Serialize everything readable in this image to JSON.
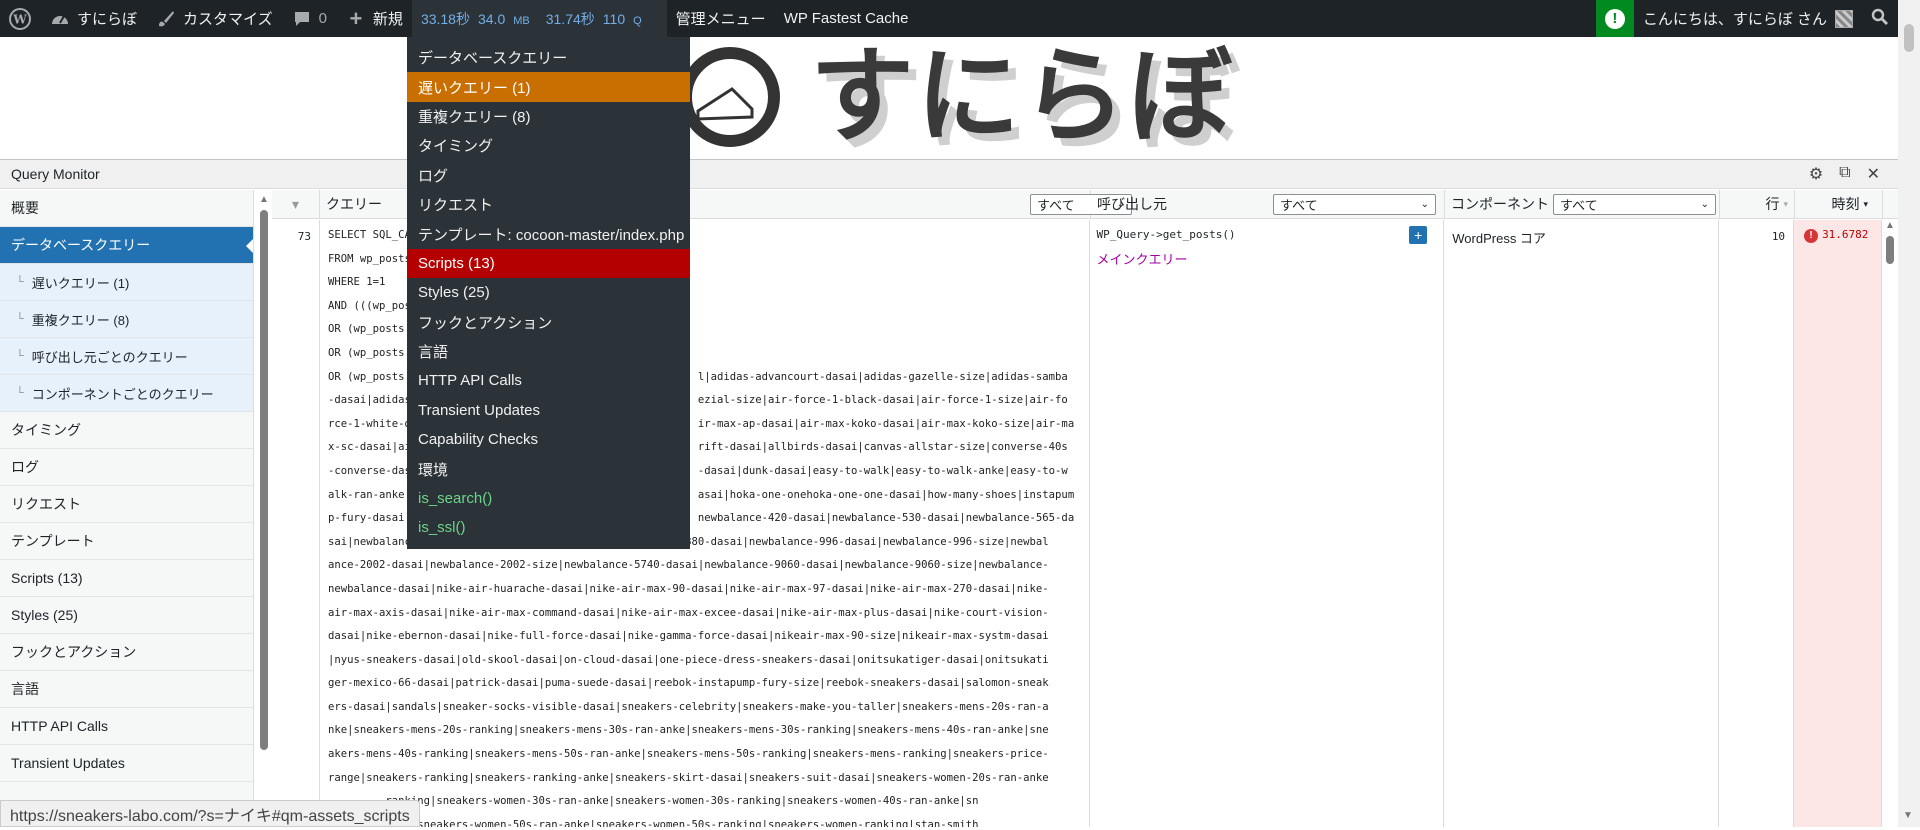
{
  "adminbar": {
    "site_name": "すにらぼ",
    "customize": "カスタマイズ",
    "comments_count": "0",
    "new": "新規",
    "qm_time": "33.18秒",
    "qm_memory": "34.0",
    "qm_memory_unit": "MB",
    "qm_db_time": "31.74秒",
    "qm_queries": "110",
    "qm_queries_unit": "Q",
    "admin_menu": "管理メニュー",
    "wp_fastest_cache": "WP Fastest Cache",
    "greeting": "こんにちは、すにらぼ さん"
  },
  "site": {
    "logo_text": "すにらぼ"
  },
  "qm_menu": [
    {
      "label": "データベースクエリー",
      "kind": "normal"
    },
    {
      "label": "遅いクエリー (1)",
      "kind": "warn"
    },
    {
      "label": "重複クエリー (8)",
      "kind": "normal"
    },
    {
      "label": "タイミング",
      "kind": "normal"
    },
    {
      "label": "ログ",
      "kind": "normal"
    },
    {
      "label": "リクエスト",
      "kind": "normal"
    },
    {
      "label": "テンプレート: cocoon-master/index.php",
      "kind": "normal"
    },
    {
      "label": "Scripts (13)",
      "kind": "error"
    },
    {
      "label": "Styles (25)",
      "kind": "normal"
    },
    {
      "label": "フックとアクション",
      "kind": "normal"
    },
    {
      "label": "言語",
      "kind": "normal"
    },
    {
      "label": "HTTP API Calls",
      "kind": "normal"
    },
    {
      "label": "Transient Updates",
      "kind": "normal"
    },
    {
      "label": "Capability Checks",
      "kind": "normal"
    },
    {
      "label": "環境",
      "kind": "normal"
    },
    {
      "label": "is_search()",
      "kind": "green"
    },
    {
      "label": "is_ssl()",
      "kind": "green"
    }
  ],
  "qm_panel": {
    "title": "Query Monitor",
    "nav": [
      {
        "label": "概要",
        "kind": "normal"
      },
      {
        "label": "データベースクエリー",
        "kind": "active"
      },
      {
        "label": "遅いクエリー (1)",
        "kind": "sub"
      },
      {
        "label": "重複クエリー (8)",
        "kind": "sub"
      },
      {
        "label": "呼び出し元ごとのクエリー",
        "kind": "sub"
      },
      {
        "label": "コンポーネントごとのクエリー",
        "kind": "sub"
      },
      {
        "label": "タイミング",
        "kind": "normal"
      },
      {
        "label": "ログ",
        "kind": "normal"
      },
      {
        "label": "リクエスト",
        "kind": "normal"
      },
      {
        "label": "テンプレート",
        "kind": "normal"
      },
      {
        "label": "Scripts (13)",
        "kind": "normal"
      },
      {
        "label": "Styles (25)",
        "kind": "normal"
      },
      {
        "label": "フックとアクション",
        "kind": "normal"
      },
      {
        "label": "言語",
        "kind": "normal"
      },
      {
        "label": "HTTP API Calls",
        "kind": "normal"
      },
      {
        "label": "Transient Updates",
        "kind": "normal"
      }
    ],
    "columns": {
      "query": "クエリー",
      "query_filter": "すべて",
      "caller": "呼び出し元",
      "caller_filter": "すべて",
      "component": "コンポーネント",
      "component_filter": "すべて",
      "rows": "行",
      "time": "時刻"
    },
    "row": {
      "number": "73",
      "sql_lines": [
        "SELECT SQL_CA",
        "FROM wp_posts",
        "WHERE 1=1",
        "AND (((wp_pos",
        "OR (wp_posts.",
        "OR (wp_posts.",
        "OR (wp_posts.                                             l|adidas-advancourt-dasai|adidas-gazelle-size|adidas-samba",
        "-dasai|adidas                                             ezial-size|air-force-1-black-dasai|air-force-1-size|air-fo",
        "rce-1-white-d                                             ir-max-ap-dasai|air-max-koko-dasai|air-max-koko-size|air-ma",
        "x-sc-dasai|ai                                             rift-dasai|allbirds-dasai|canvas-allstar-size|converse-40s",
        "-converse-das                                             -dasai|dunk-dasai|easy-to-walk|easy-to-walk-anke|easy-to-w",
        "alk-ran-anke|                                             asai|hoka-one-onehoka-one-one-dasai|how-many-shoes|instapum",
        "p-fury-dasai|                                             newbalance-420-dasai|newbalance-530-dasai|newbalance-565-da",
        "sai|newbalance-574-dasai|newbalance-574-size|newbalance-880-dasai|newbalance-996-dasai|newbalance-996-size|newbal",
        "ance-2002-dasai|newbalance-2002-size|newbalance-5740-dasai|newbalance-9060-dasai|newbalance-9060-size|newbalance-",
        "newbalance-dasai|nike-air-huarache-dasai|nike-air-max-90-dasai|nike-air-max-97-dasai|nike-air-max-270-dasai|nike-",
        "air-max-axis-dasai|nike-air-max-command-dasai|nike-air-max-excee-dasai|nike-air-max-plus-dasai|nike-court-vision-",
        "dasai|nike-ebernon-dasai|nike-full-force-dasai|nike-gamma-force-dasai|nikeair-max-90-size|nikeair-max-systm-dasai",
        "|nyus-sneakers-dasai|old-skool-dasai|on-cloud-dasai|one-piece-dress-sneakers-dasai|onitsukatiger-dasai|onitsukati",
        "ger-mexico-66-dasai|patrick-dasai|puma-suede-dasai|reebok-instapump-fury-size|reebok-sneakers-dasai|salomon-sneak",
        "ers-dasai|sandals|sneaker-socks-visible-dasai|sneakers-celebrity|sneakers-make-you-taller|sneakers-mens-20s-ran-a",
        "nke|sneakers-mens-20s-ranking|sneakers-mens-30s-ran-anke|sneakers-mens-30s-ranking|sneakers-mens-40s-ran-anke|sne",
        "akers-mens-40s-ranking|sneakers-mens-50s-ran-anke|sneakers-mens-50s-ranking|sneakers-mens-ranking|sneakers-price-",
        "range|sneakers-ranking|sneakers-ranking-anke|sneakers-skirt-dasai|sneakers-suit-dasai|sneakers-women-20s-ran-anke",
        "         ranking|sneakers-women-30s-ran-anke|sneakers-women-30s-ranking|sneakers-women-40s-ran-anke|sn",
        "         king|sneakers-women-50s-ran-anke|sneakers-women-50s-ranking|sneakers-women-ranking|stan-smith"
      ],
      "caller": "WP_Query->get_posts()",
      "caller_sub": "メインクエリー",
      "component": "WordPress コア",
      "rows": "10",
      "time": "31.6782"
    }
  },
  "statusbar": {
    "url": "https://sneakers-labo.com/?s=ナイキ#qm-assets_scripts"
  },
  "colors": {
    "adminbar_bg": "#1d2327",
    "qm_link": "#72aee6",
    "active_nav": "#2271b1",
    "warning": "#c96e00",
    "error": "#b50000",
    "alert_green": "#008a20"
  }
}
